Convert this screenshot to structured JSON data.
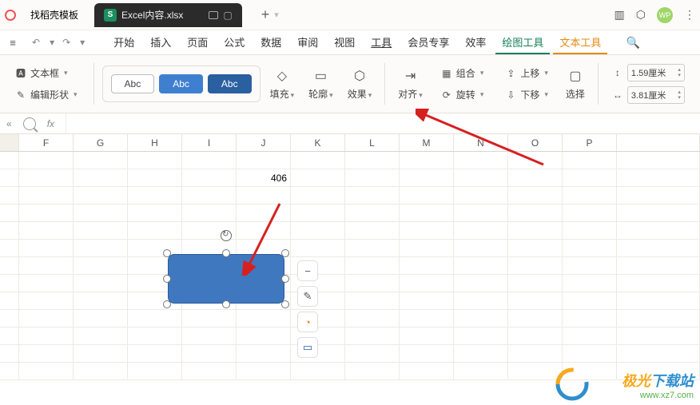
{
  "titlebar": {
    "tab1": "找稻壳模板",
    "tab2": "Excel内容.xlsx",
    "wp": "WP"
  },
  "menu": {
    "items": [
      "开始",
      "插入",
      "页面",
      "公式",
      "数据",
      "审阅",
      "视图",
      "工具",
      "会员专享",
      "效率",
      "绘图工具",
      "文本工具"
    ]
  },
  "ribbon": {
    "textbox": "文本框",
    "editshape": "编辑形状",
    "abc1": "Abc",
    "abc2": "Abc",
    "abc3": "Abc",
    "fill": "填充",
    "outline": "轮廓",
    "effect": "效果",
    "align": "对齐",
    "group": "组合",
    "rotate": "旋转",
    "up": "上移",
    "down": "下移",
    "select": "选择",
    "height_val": "1.59厘米",
    "width_val": "3.81厘米"
  },
  "formula": {
    "fx": "fx"
  },
  "cols": [
    "",
    "F",
    "G",
    "H",
    "I",
    "J",
    "K",
    "L",
    "M",
    "N",
    "O",
    "P",
    ""
  ],
  "cell_j": "406",
  "watermark": {
    "brand_pre": "极光",
    "brand_suf": "下载站",
    "url": "www.xz7.com"
  }
}
